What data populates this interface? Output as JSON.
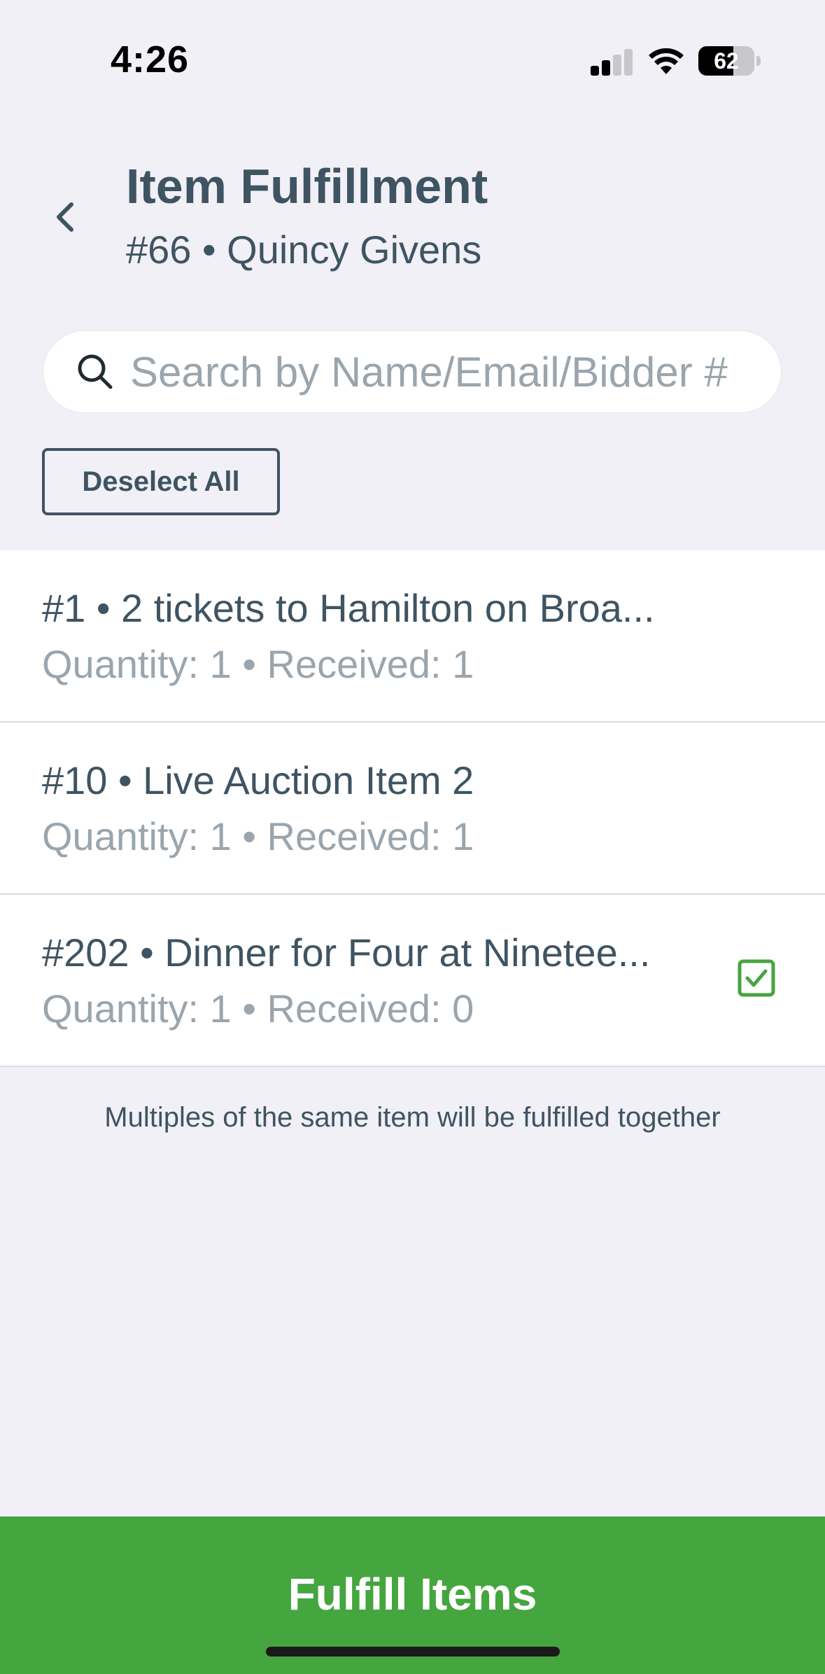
{
  "status_bar": {
    "time": "4:26",
    "battery": "62",
    "battery_level": 0.62,
    "signal_bars_active": 2
  },
  "header": {
    "title": "Item Fulfillment",
    "subtitle": "#66 • Quincy Givens"
  },
  "search": {
    "placeholder": "Search by Name/Email/Bidder #",
    "value": ""
  },
  "toolbar": {
    "deselect_label": "Deselect All"
  },
  "items": [
    {
      "title": "#1 • 2 tickets to Hamilton on Broa...",
      "meta": "Quantity: 1 • Received: 1",
      "selected": false
    },
    {
      "title": "#10 • Live Auction Item 2",
      "meta": "Quantity: 1 • Received: 1",
      "selected": false
    },
    {
      "title": "#202 • Dinner for Four at Ninetee...",
      "meta": "Quantity: 1 • Received: 0",
      "selected": true
    }
  ],
  "footnote": "Multiples of the same item will be fulfilled together",
  "fulfill": {
    "label": "Fulfill Items"
  },
  "colors": {
    "accent": "#45a53f",
    "text_primary": "#3f5462",
    "text_muted": "#9aa5ad",
    "background": "#f1f0f6"
  }
}
